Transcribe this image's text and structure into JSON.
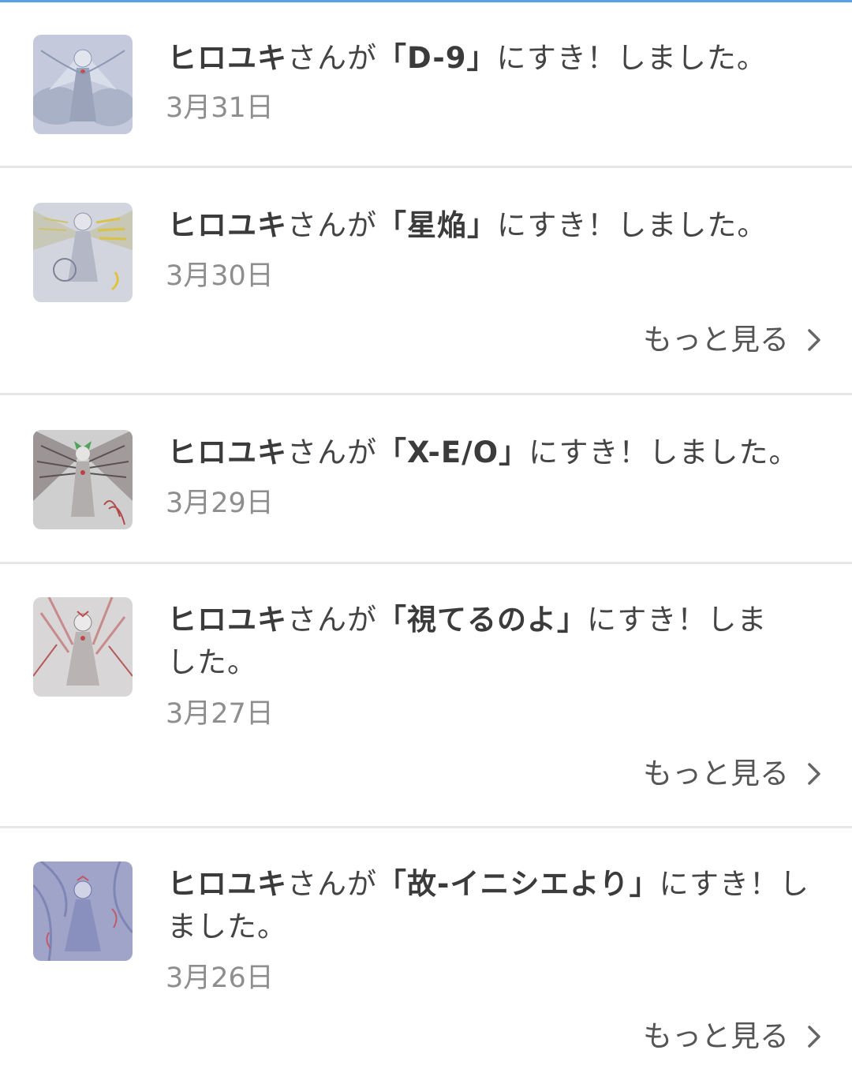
{
  "notifications": [
    {
      "user": "ヒロユキ",
      "mid": "さんが",
      "title": "「D-9」",
      "tail": "にすき！しました。",
      "date": "3月31日"
    },
    {
      "user": "ヒロユキ",
      "mid": "さんが",
      "title": "「星焔」",
      "tail": "にすき！しました。",
      "date": "3月30日"
    },
    {
      "user": "ヒロユキ",
      "mid": "さんが",
      "title": "「X-E/O」",
      "tail": "にすき！しました。",
      "date": "3月29日"
    },
    {
      "user": "ヒロユキ",
      "mid": "さんが",
      "title": "「視てるのよ」",
      "tail": "にすき！しました。",
      "date": "3月27日"
    },
    {
      "user": "ヒロユキ",
      "mid": "さんが",
      "title": "「故-イニシエより」",
      "tail": "にすき！しました。",
      "date": "3月26日"
    }
  ],
  "more_label": "もっと見る",
  "colors": {
    "accent_top": "#5aa0e6",
    "divider": "#e7e7e7",
    "date": "#8e8e8e"
  }
}
